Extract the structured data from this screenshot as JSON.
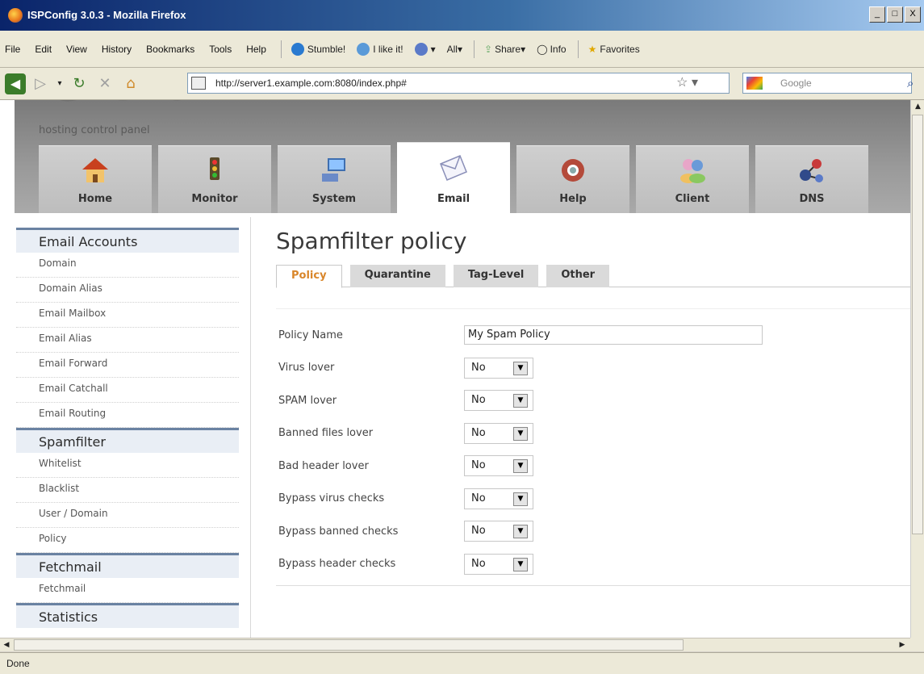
{
  "window": {
    "title": "ISPConfig 3.0.3 - Mozilla Firefox",
    "min": "_",
    "max": "□",
    "close": "X"
  },
  "menubar": {
    "items": [
      "File",
      "Edit",
      "View",
      "History",
      "Bookmarks",
      "Tools",
      "Help"
    ],
    "toolbar": {
      "stumble": "Stumble!",
      "ilike": "I like it!",
      "all": "All",
      "share": "Share",
      "info": "Info",
      "favorites": "Favorites"
    }
  },
  "nav": {
    "url": "http://server1.example.com:8080/index.php#",
    "search_placeholder": "Google"
  },
  "header": {
    "tagline": "hosting control panel",
    "modules": [
      {
        "label": "Home",
        "icon": "home-icon",
        "color": "#c8401e"
      },
      {
        "label": "Monitor",
        "icon": "traffic-light-icon",
        "color": "#7a6a3a"
      },
      {
        "label": "System",
        "icon": "computer-icon",
        "color": "#3f6fb0"
      },
      {
        "label": "Email",
        "icon": "envelope-icon",
        "color": "#8a8fb8"
      },
      {
        "label": "Help",
        "icon": "lifebuoy-icon",
        "color": "#b44a3a"
      },
      {
        "label": "Client",
        "icon": "users-icon",
        "color": "#6a9ad8"
      },
      {
        "label": "DNS",
        "icon": "network-icon",
        "color": "#304a8a"
      }
    ],
    "active_module": "Email"
  },
  "sidebar": {
    "sections": [
      {
        "title": "Email Accounts",
        "items": [
          "Domain",
          "Domain Alias",
          "Email Mailbox",
          "Email Alias",
          "Email Forward",
          "Email Catchall",
          "Email Routing"
        ]
      },
      {
        "title": "Spamfilter",
        "items": [
          "Whitelist",
          "Blacklist",
          "User / Domain",
          "Policy"
        ]
      },
      {
        "title": "Fetchmail",
        "items": [
          "Fetchmail"
        ]
      },
      {
        "title": "Statistics",
        "items": []
      }
    ]
  },
  "main": {
    "title": "Spamfilter policy",
    "tabs": [
      "Policy",
      "Quarantine",
      "Tag-Level",
      "Other"
    ],
    "active_tab": "Policy",
    "fields": {
      "policy_name": {
        "label": "Policy Name",
        "value": "My Spam Policy"
      },
      "selects": [
        {
          "label": "Virus lover",
          "value": "No"
        },
        {
          "label": "SPAM lover",
          "value": "No"
        },
        {
          "label": "Banned files lover",
          "value": "No"
        },
        {
          "label": "Bad header lover",
          "value": "No"
        },
        {
          "label": "Bypass virus checks",
          "value": "No"
        },
        {
          "label": "Bypass banned checks",
          "value": "No"
        },
        {
          "label": "Bypass header checks",
          "value": "No"
        }
      ]
    }
  },
  "status": {
    "text": "Done"
  }
}
